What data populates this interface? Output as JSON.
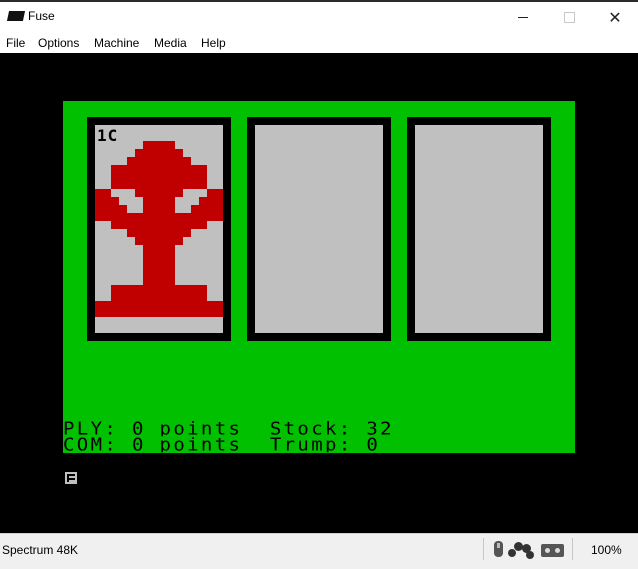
{
  "window": {
    "title": "Fuse",
    "minimize_glyph": "",
    "maximize_glyph": "",
    "close_glyph": "✕"
  },
  "menu": [
    "File",
    "Options",
    "Machine",
    "Media",
    "Help"
  ],
  "game": {
    "cards": [
      {
        "label": "1C",
        "suit_color": "#c00000",
        "empty": false
      },
      {
        "label": "",
        "empty": true
      },
      {
        "label": "",
        "empty": true
      }
    ],
    "status": {
      "ply_label": "PLY:",
      "ply_points": "0",
      "ply_unit": "points",
      "com_label": "COM:",
      "com_points": "0",
      "com_unit": "points",
      "stock_label": "Stock:",
      "stock_value": "32",
      "trump_label": "Trump:",
      "trump_value": "0"
    },
    "colors": {
      "table": "#00c000",
      "card_face": "#c0c0c0",
      "border": "#000000",
      "suit": "#c00000"
    }
  },
  "statusbar": {
    "machine": "Spectrum 48K",
    "zoom": "100%",
    "icons": [
      "mouse-icon",
      "joystick-icon",
      "tape-icon"
    ]
  }
}
